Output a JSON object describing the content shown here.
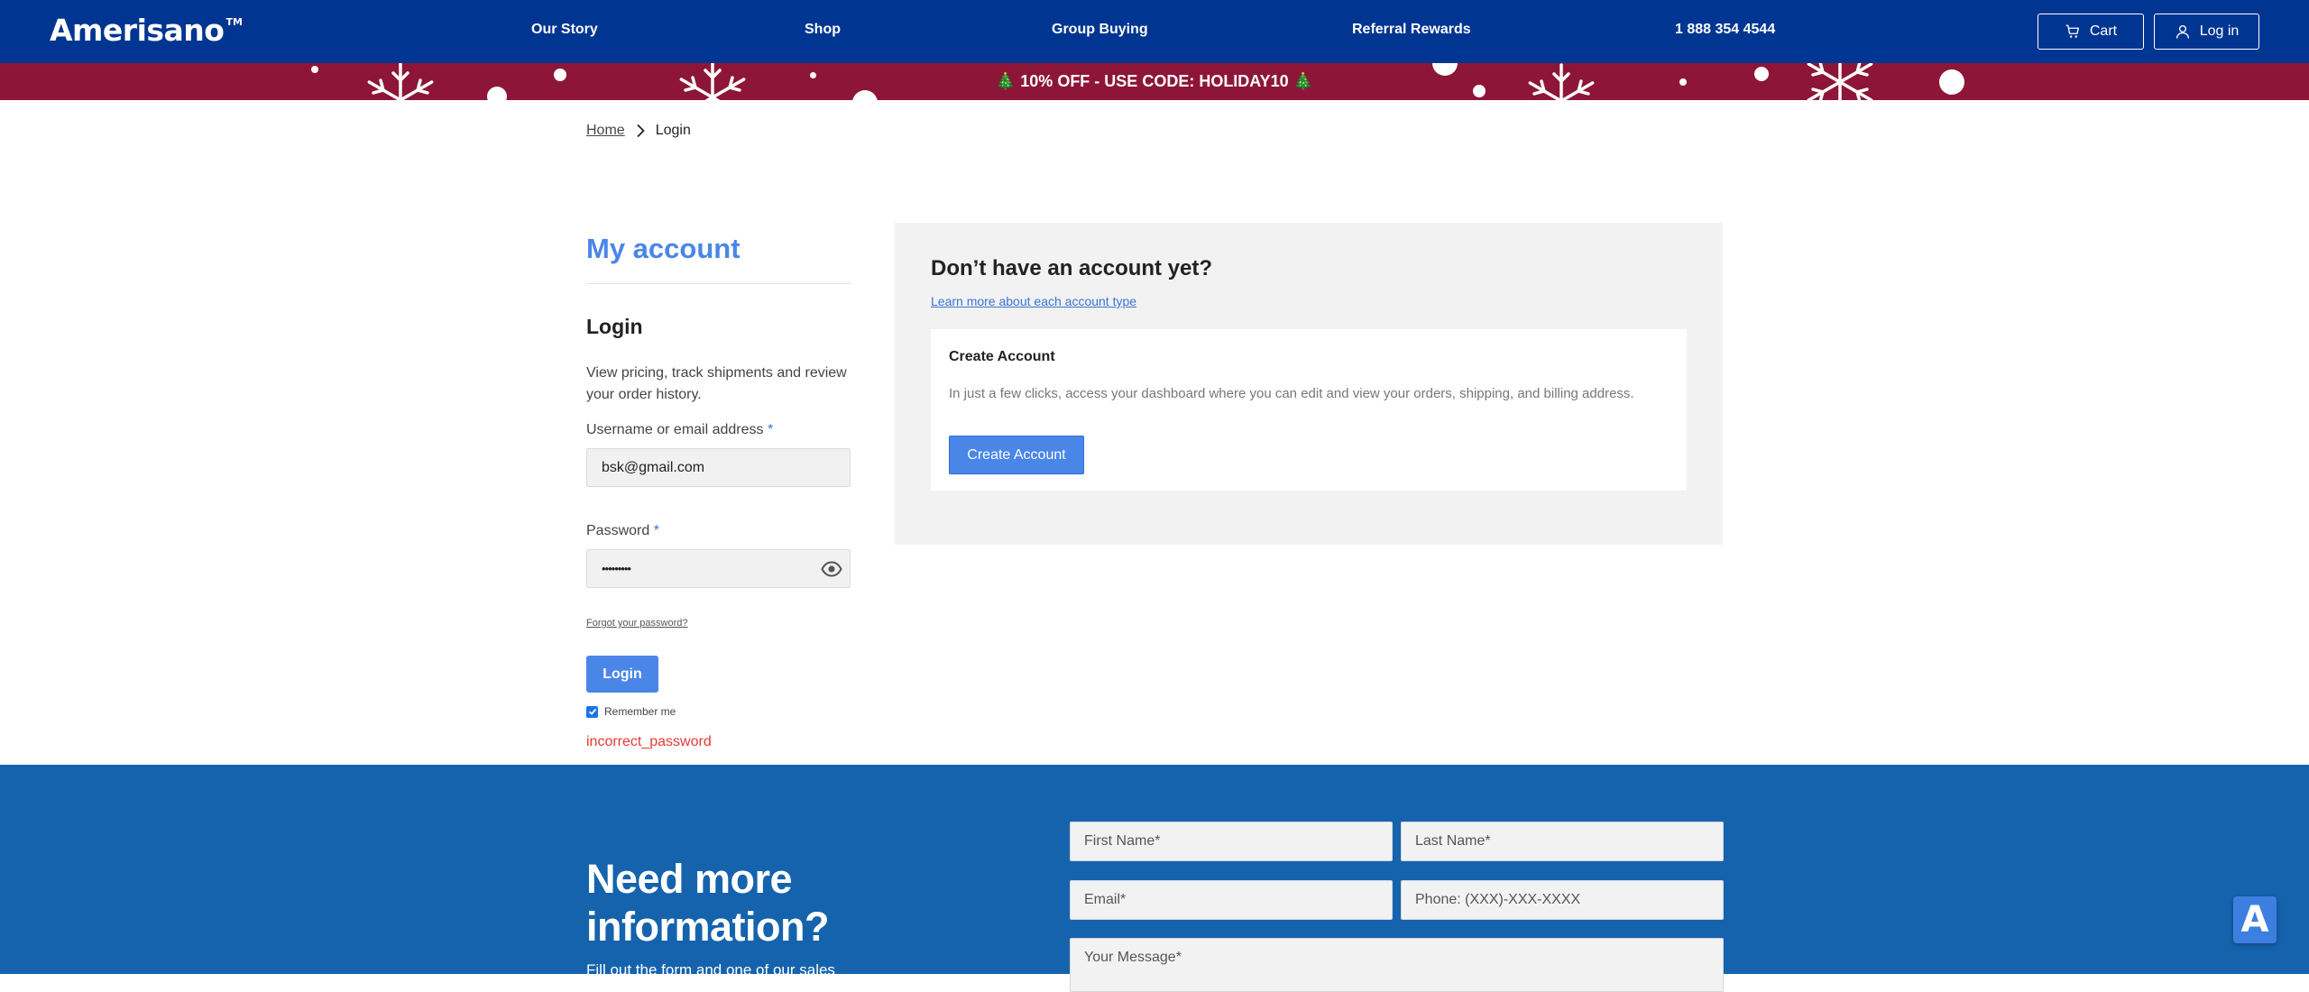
{
  "header": {
    "logo": "Amerisano",
    "logo_tm": "TM",
    "nav": [
      "Our Story",
      "Shop",
      "Group Buying",
      "Referral Rewards",
      "1 888 354 4544"
    ],
    "cart_label": "Cart",
    "login_label": "Log in"
  },
  "promo": {
    "text": "🎄 10% OFF - USE CODE: HOLIDAY10 🎄",
    "background": "#8d1638"
  },
  "breadcrumb": {
    "home": "Home",
    "current": "Login"
  },
  "account": {
    "title": "My account",
    "login_title": "Login",
    "description": "View pricing, track shipments and review your order history.",
    "username_label": "Username or email address",
    "username_value": "bsk@gmail.com",
    "password_label": "Password",
    "password_value": "•••••••••",
    "required_mark": "*",
    "forgot_link": "Forgot your password?",
    "login_button": "Login",
    "remember_label": "Remember me",
    "remember_checked": true,
    "error": "incorrect_password"
  },
  "register": {
    "title": "Don’t have an account yet?",
    "learn_link": "Learn more about each account type",
    "card_title": "Create Account",
    "card_description": "In just a few clicks, access your dashboard where you can edit and view your orders, shipping, and billing address.",
    "create_button": "Create Account"
  },
  "contact": {
    "heading": "Need more information?",
    "subtext": "Fill out the form and one of our sales",
    "first_name": "First Name*",
    "last_name": "Last Name*",
    "email": "Email*",
    "phone": "Phone: (XXX)-XXX-XXXX",
    "message": "Your Message*"
  },
  "widget": {
    "letter": "A"
  },
  "colors": {
    "header_bg": "#003591",
    "accent": "#4a86e8",
    "footer_bg": "#1563ad",
    "error": "#e53935"
  },
  "icons": [
    "cart-icon",
    "user-icon",
    "chevron-right-icon",
    "eye-icon",
    "snowflake-icon",
    "check-icon"
  ]
}
